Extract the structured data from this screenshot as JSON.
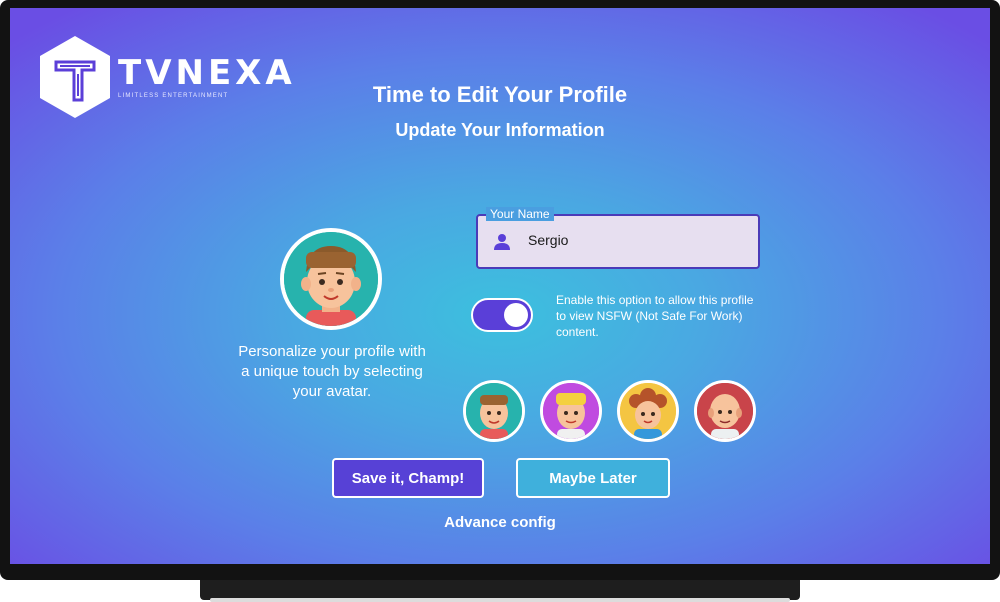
{
  "brand": {
    "name": "TVNEXA",
    "tagline": "LIMITLESS ENTERTAINMENT"
  },
  "header": {
    "title": "Time to Edit Your Profile",
    "subtitle": "Update Your Information"
  },
  "avatar": {
    "caption": "Personalize your profile with a unique touch by selecting your avatar."
  },
  "name_field": {
    "label": "Your Name",
    "value": "Sergio",
    "icon": "person-icon"
  },
  "nsfw_toggle": {
    "enabled": true,
    "description": "Enable this option to allow this profile to view NSFW (Not Safe For Work) content."
  },
  "avatar_choices": [
    "avatar-brown-hair-boy",
    "avatar-blonde-boy",
    "avatar-curly-girl",
    "avatar-bald-man"
  ],
  "buttons": {
    "save": "Save it, Champ!",
    "later": "Maybe Later"
  },
  "advance_link": "Advance config",
  "colors": {
    "accent": "#5741d6",
    "secondary": "#3fb0dc",
    "field_bg": "#e7dff0"
  }
}
